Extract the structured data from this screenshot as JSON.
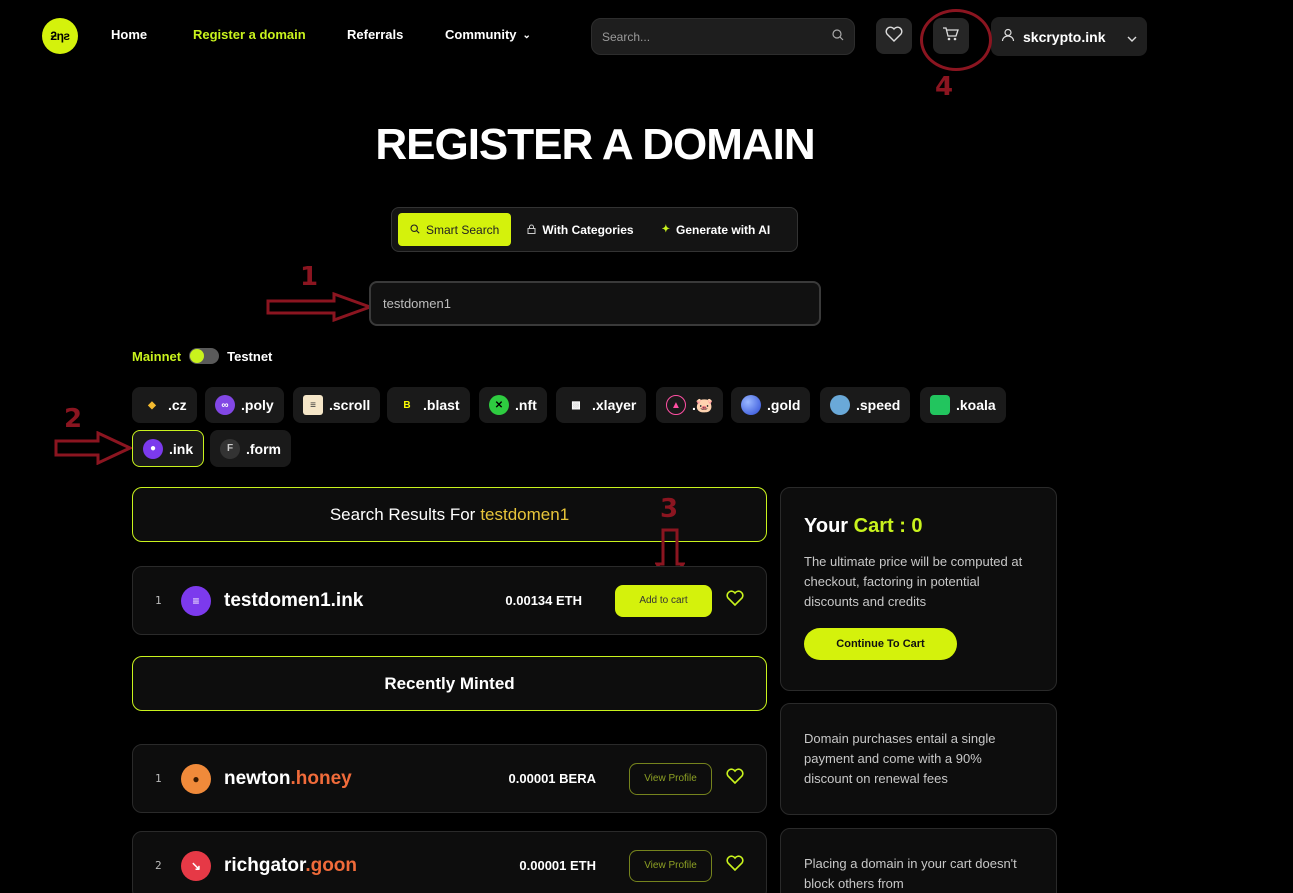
{
  "header": {
    "logo_text": "ƻƞƨ",
    "nav": [
      {
        "label": "Home"
      },
      {
        "label": "Register a domain"
      },
      {
        "label": "Referrals"
      },
      {
        "label": "Community"
      }
    ],
    "search_placeholder": "Search...",
    "user_name": "skcrypto.ink"
  },
  "page": {
    "title": "REGISTER A DOMAIN",
    "modes": [
      {
        "label": "Smart Search"
      },
      {
        "label": "With Categories"
      },
      {
        "label": "Generate with AI"
      }
    ],
    "domain_input_value": "testdomen1",
    "network": {
      "mainnet": "Mainnet",
      "testnet": "Testnet"
    }
  },
  "tlds": [
    {
      "label": ".cz",
      "icon": "cz-icon",
      "color": "#f3ba2f"
    },
    {
      "label": ".poly",
      "icon": "poly-icon",
      "color": "#8247e5"
    },
    {
      "label": ".scroll",
      "icon": "scroll-icon",
      "color": "#f5e6c8"
    },
    {
      "label": ".blast",
      "icon": "blast-icon",
      "color": "#fcfc03"
    },
    {
      "label": ".nft",
      "icon": "nft-icon",
      "color": "#2ecc40"
    },
    {
      "label": ".xlayer",
      "icon": "xlayer-icon",
      "color": "#ffffff"
    },
    {
      "label": ".🐷",
      "icon": "pig-icon",
      "color": "#ff4fa3"
    },
    {
      "label": ".gold",
      "icon": "gold-icon",
      "color": "#4a78ff"
    },
    {
      "label": ".speed",
      "icon": "speed-icon",
      "color": "#6aa9d8"
    },
    {
      "label": ".koala",
      "icon": "koala-icon",
      "color": "#22c55e"
    },
    {
      "label": ".ink",
      "icon": "ink-icon",
      "color": "#7c3aed"
    },
    {
      "label": ".form",
      "icon": "form-icon",
      "color": "#333333"
    }
  ],
  "results": {
    "heading_prefix": "Search Results For",
    "query": "testdomen1",
    "items": [
      {
        "index": "1",
        "name": "testdomen1.ink",
        "price": "0.00134 ETH",
        "action": "Add to cart"
      }
    ]
  },
  "recent": {
    "heading": "Recently Minted",
    "items": [
      {
        "index": "1",
        "name": "newton",
        "tld": ".honey",
        "price": "0.00001 BERA",
        "action": "View Profile"
      },
      {
        "index": "2",
        "name": "richgator",
        "tld": ".goon",
        "price": "0.00001 ETH",
        "action": "View Profile"
      }
    ]
  },
  "cart": {
    "title_your": "Your",
    "title_cart": "Cart : 0",
    "description": "The ultimate price will be computed at checkout, factoring in potential discounts and credits",
    "button": "Continue To Cart"
  },
  "info_cards": [
    "Domain purchases entail a single payment and come with a 90% discount on renewal fees",
    "Placing a domain in your cart doesn't block others from"
  ],
  "annotations": [
    "1",
    "2",
    "3",
    "4"
  ],
  "colors": {
    "accent": "#d4f20c",
    "annotation": "#8b1520",
    "background": "#000000"
  }
}
